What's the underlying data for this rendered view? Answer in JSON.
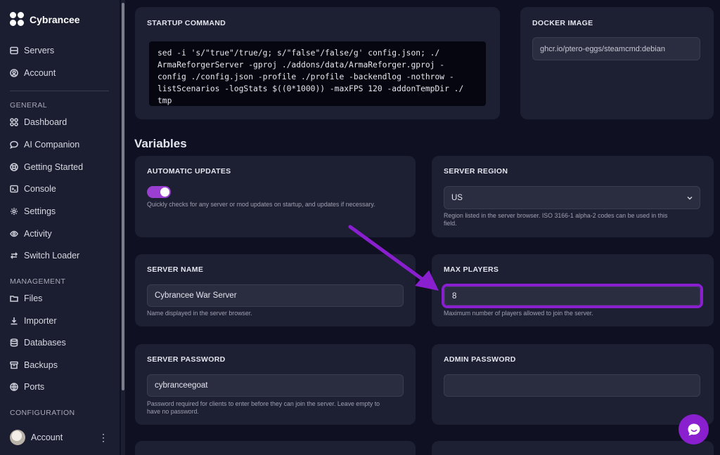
{
  "app": {
    "brand": "Cybrancee"
  },
  "sidebar": {
    "top_items": [
      {
        "label": "Servers",
        "icon": "server-icon"
      },
      {
        "label": "Account",
        "icon": "account-icon"
      }
    ],
    "sections": [
      {
        "title": "GENERAL",
        "items": [
          {
            "label": "Dashboard",
            "icon": "dashboard-icon"
          },
          {
            "label": "AI Companion",
            "icon": "chat-bubble-icon"
          },
          {
            "label": "Getting Started",
            "icon": "lifebuoy-icon"
          },
          {
            "label": "Console",
            "icon": "terminal-icon"
          },
          {
            "label": "Settings",
            "icon": "gear-icon"
          },
          {
            "label": "Activity",
            "icon": "eye-icon"
          },
          {
            "label": "Switch Loader",
            "icon": "switch-arrows-icon"
          }
        ]
      },
      {
        "title": "MANAGEMENT",
        "items": [
          {
            "label": "Files",
            "icon": "files-icon"
          },
          {
            "label": "Importer",
            "icon": "download-icon"
          },
          {
            "label": "Databases",
            "icon": "database-icon"
          },
          {
            "label": "Backups",
            "icon": "archive-icon"
          },
          {
            "label": "Ports",
            "icon": "globe-icon"
          }
        ]
      },
      {
        "title": "CONFIGURATION",
        "items": []
      }
    ],
    "account_bottom": {
      "label": "Account"
    }
  },
  "startup": {
    "title": "STARTUP COMMAND",
    "lines": [
      "sed -i 's/\"true\"/true/g; s/\"false\"/false/g' config.json; ./",
      "ArmaReforgerServer -gproj ./addons/data/ArmaReforger.gproj -",
      "config ./config.json -profile ./profile -backendlog -nothrow -",
      "listScenarios -logStats $((0*1000)) -maxFPS 120 -addonTempDir ./",
      "tmp"
    ]
  },
  "docker": {
    "title": "DOCKER IMAGE",
    "value": "ghcr.io/ptero-eggs/steamcmd:debian"
  },
  "variables": {
    "heading": "Variables",
    "auto_updates": {
      "title": "AUTOMATIC UPDATES",
      "enabled": true,
      "hint": "Quickly checks for any server or mod updates on startup, and updates if necessary."
    },
    "server_region": {
      "title": "SERVER REGION",
      "value": "US",
      "hint1": "Region listed in the server browser. ISO 3166-1 alpha-2 codes can be used in this",
      "hint2": "field."
    },
    "server_name": {
      "title": "SERVER NAME",
      "value": "Cybrancee War Server",
      "hint": "Name displayed in the server browser."
    },
    "max_players": {
      "title": "MAX PLAYERS",
      "value": "8",
      "hint": "Maximum number of players allowed to join the server."
    },
    "server_password": {
      "title": "SERVER PASSWORD",
      "value": "cybranceegoat",
      "hint1": "Password required for clients to enter before they can join the server. Leave empty to",
      "hint2": "have no password."
    },
    "admin_password": {
      "title": "ADMIN PASSWORD",
      "value": ""
    }
  },
  "colors": {
    "accent": "#8a1fd0",
    "background": "#0f1123",
    "card": "#1d1f33"
  }
}
